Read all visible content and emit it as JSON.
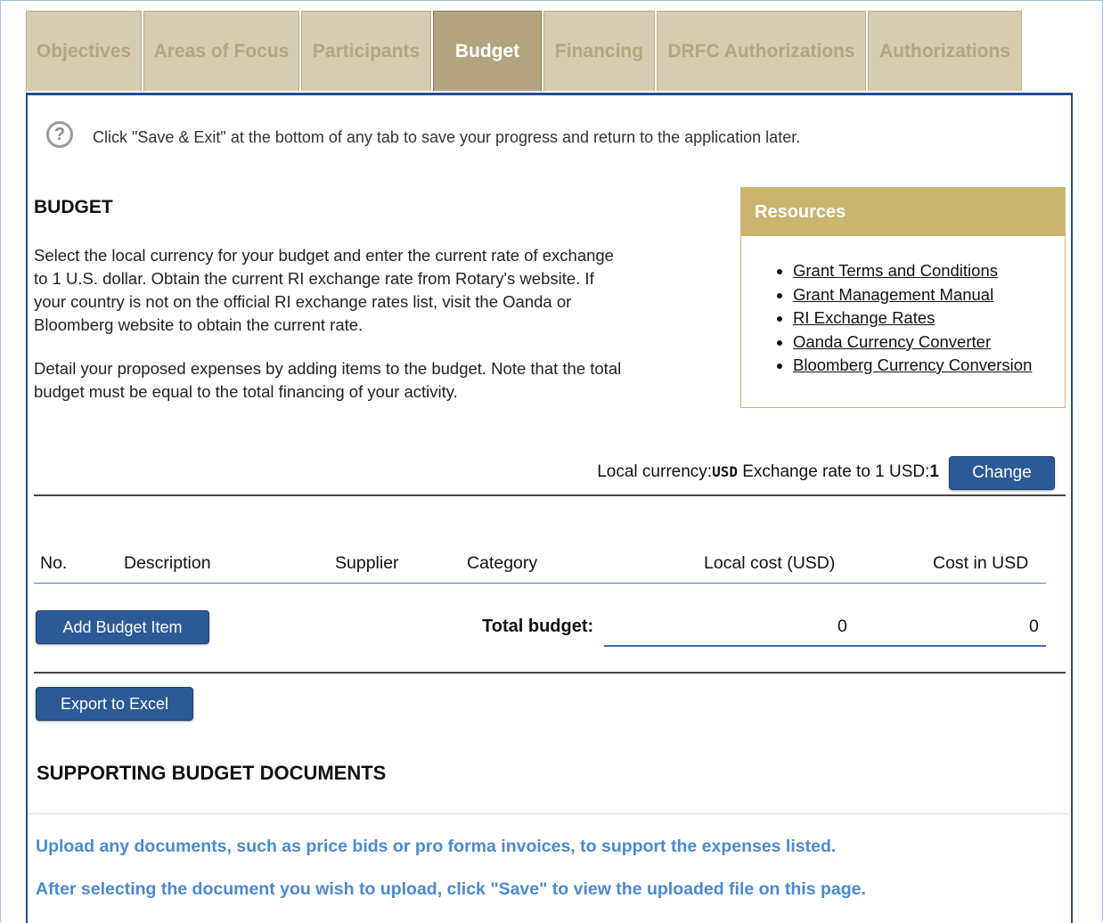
{
  "tabs": [
    {
      "label": "Objectives",
      "active": false
    },
    {
      "label": "Areas of Focus",
      "active": false
    },
    {
      "label": "Participants",
      "active": false
    },
    {
      "label": "Budget",
      "active": true
    },
    {
      "label": "Financing",
      "active": false
    },
    {
      "label": "DRFC Authorizations",
      "active": false
    },
    {
      "label": "Authorizations",
      "active": false
    }
  ],
  "info": {
    "icon": "question-circle-icon",
    "text": "Click \"Save & Exit\" at the bottom of any tab to save your progress and return to the application later."
  },
  "budget": {
    "heading": "BUDGET",
    "para1_lines": [
      "Select the local currency for your budget and enter the current rate of exchange",
      "to 1 U.S. dollar. Obtain the current RI exchange rate from Rotary's website. If",
      "your country is not on the official RI exchange rates list, visit the Oanda or",
      "Bloomberg website to obtain the current rate."
    ],
    "para2_lines": [
      "Detail your proposed expenses by adding items to the budget. Note that the total",
      "budget must be equal to the total financing of your activity."
    ]
  },
  "resources": {
    "title": "Resources",
    "links": [
      "Grant Terms and Conditions",
      "Grant Management Manual",
      "RI Exchange Rates",
      "Oanda Currency Converter",
      "Bloomberg Currency Conversion"
    ]
  },
  "currency": {
    "local_label": "Local currency:",
    "local_value": "USD",
    "rate_label": " Exchange rate to 1 USD:",
    "rate_value": "1",
    "change_button": "Change"
  },
  "table": {
    "columns": [
      "No.",
      "Description",
      "Supplier",
      "Category",
      "Local cost (USD)",
      "Cost in USD"
    ],
    "rows": [],
    "add_button": "Add Budget Item",
    "total_label": "Total budget:",
    "total_local": "0",
    "total_usd": "0"
  },
  "export_button": "Export to Excel",
  "supporting": {
    "heading": "SUPPORTING BUDGET DOCUMENTS",
    "note1": "Upload any documents, such as price bids or pro forma invoices, to support the expenses listed.",
    "note2": "After selecting the document you wish to upload, click \"Save\" to view the uploaded file on this page."
  },
  "colors": {
    "tab_bg": "#d7ccb1",
    "tab_active_bg": "#b3a47d",
    "accent_blue": "#2b5a96",
    "resources_header": "#c8b46c",
    "note_blue": "#4a8ad0"
  }
}
